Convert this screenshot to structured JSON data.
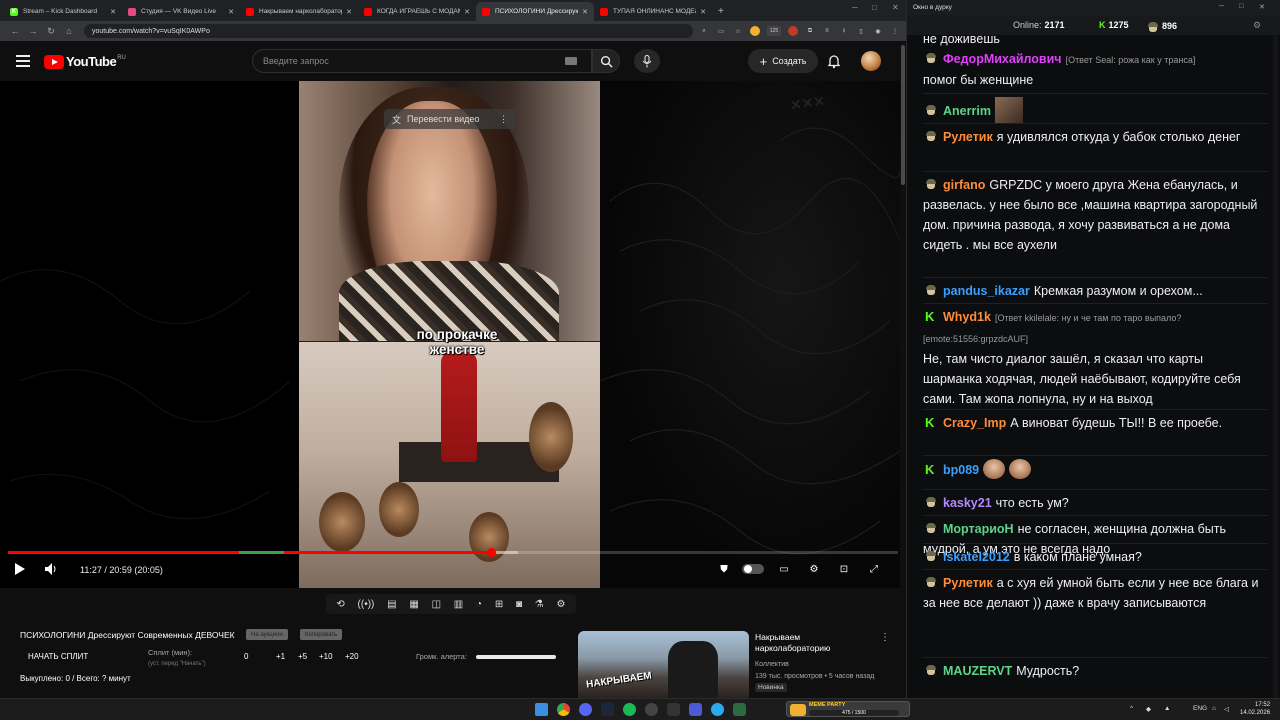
{
  "browser": {
    "tabs": [
      {
        "title": "Stream – Kick Dashboard",
        "color": "#53fc18",
        "glyph": "K",
        "active": false
      },
      {
        "title": "Студия — VK Видео Live",
        "color": "#e64980",
        "glyph": "",
        "active": false
      },
      {
        "title": "Накрываем нарколабораторию",
        "color": "#ff0000",
        "glyph": "",
        "active": false
      },
      {
        "title": "КОГДА ИГРАЕШЬ С МОДАМИ",
        "color": "#ff0000",
        "glyph": "",
        "active": false
      },
      {
        "title": "ПСИХОЛОГИНИ Дрессируют",
        "color": "#ff0000",
        "glyph": "",
        "active": true
      },
      {
        "title": "ТУПАЯ ОНЛИНАНС МОДЕЛЬ",
        "color": "#ff0000",
        "glyph": "",
        "active": false
      }
    ],
    "url": "youtube.com/watch?v=vuSqIK0AWPo",
    "ext_badge_count": "125"
  },
  "youtube": {
    "logo_text": "YouTube",
    "region_code": "RU",
    "search_placeholder": "Введите запрос",
    "create_label": "Создать",
    "translate_label": "Перевести видео",
    "video_caption_line1": "по прокачке",
    "video_caption_line2": "женстве",
    "time_display": "11:27 / 20:59 (20:05)",
    "progress": {
      "played_fraction": 0.543,
      "buffered_fraction": 0.573,
      "green_start": 0.26,
      "green_end": 0.31
    },
    "colors": {
      "accent": "#ff0000"
    }
  },
  "below_video": {
    "title": "ПСИХОЛОГИНИ Дрессируют Современных ДЕВОЧЕК",
    "grey_btn_1": "На аукцион",
    "grey_btn_2": "Копировать",
    "start_split": "НАЧАТЬ СПЛИТ",
    "split_label": "Сплит (мин):",
    "split_sub": "(уст. перед \"Начать\")",
    "split_values": [
      "0",
      "+1",
      "+5",
      "+10",
      "+20"
    ],
    "alert_label": "Громк. алерта:",
    "bought": "Выкуплено: 0 / Всего: ? минут"
  },
  "recommendation": {
    "title": "Накрываем нарколабораторию",
    "channel": "Коллектив",
    "meta": "139 тыс. просмотров • 5 часов назад",
    "badge": "Новинка",
    "thumb_text": "НАКРЫВАЕМ"
  },
  "chat": {
    "window_title": "Окно в дурку",
    "online_label": "Online:",
    "online_count": "2171",
    "kick_count": "1275",
    "smoke_count": "896",
    "top_partial": "не доживёшь",
    "messages": [
      {
        "badge": "smoke",
        "name": "ФедорМихайлович",
        "color": "#e040fb",
        "reply": "[Ответ Seal: рожа как у транса]",
        "text": "помог бы женщине"
      },
      {
        "badge": "smoke",
        "name": "Anerrim",
        "color": "#5fd38a",
        "reply": "",
        "text": ""
      },
      {
        "badge": "smoke",
        "name": "Рулетик",
        "color": "#ff8c3a",
        "reply": "",
        "text": "я удивлялся откуда у бабок столько денег"
      },
      {
        "badge": "smoke",
        "name": "girfano",
        "color": "#ff8c3a",
        "reply": "",
        "text": "GRPZDC у моего друга Жена ебанулась, и развелась. у нее было все ,машина квартира загородный дом. причина развода, я хочу развиваться а не дома сидеть . мы все аухели"
      },
      {
        "badge": "smoke",
        "name": "pandus_ikazar",
        "color": "#3aa0ff",
        "reply": "",
        "text": "Кремкая разумом и орехом..."
      },
      {
        "badge": "kick",
        "name": "Whyd1k",
        "color": "#ff8c3a",
        "reply": "[Ответ kkilelale: ну и че там по таро выпало?",
        "emote_code": "[emote:51556:grpzdcAUF]",
        "text": "Не, там чисто диалог зашёл, я сказал что карты шарманка ходячая, людей наёбывают, кодируйте себя сами. Там жопа лопнула, ну и на выход"
      },
      {
        "badge": "kick",
        "name": "Crazy_Imp",
        "color": "#ff8c3a",
        "reply": "",
        "text": "А виноват будешь ТЫ!! В ее проебе."
      },
      {
        "badge": "kick",
        "name": "bp089",
        "color": "#3aa0ff",
        "reply": "",
        "text": ""
      },
      {
        "badge": "smoke",
        "name": "kasky21",
        "color": "#b388ff",
        "reply": "",
        "text": "что есть ум?"
      },
      {
        "badge": "smoke",
        "name": "МортариоН",
        "color": "#5fd38a",
        "reply": "",
        "text": "не согласен, женщина должна быть мудрой, а ум это не всегда надо"
      },
      {
        "badge": "smoke",
        "name": "iskatel2012",
        "color": "#3aa0ff",
        "reply": "",
        "text": "в каком плане умная?"
      },
      {
        "badge": "smoke",
        "name": "Рулетик",
        "color": "#ff8c3a",
        "reply": "",
        "text": "а с хуя ей умной быть если у нее все блага и за нее все делают )) даже к врачу записываются"
      },
      {
        "badge": "smoke",
        "name": "MAUZERVT",
        "color": "#5fd38a",
        "reply": "",
        "text": "Мудрость?"
      }
    ]
  },
  "taskbar": {
    "meme_label": "MEME PARTY",
    "meme_progress": "475 / 1500",
    "lang": "ENG",
    "time": "17:52",
    "date": "14.02.2026"
  }
}
